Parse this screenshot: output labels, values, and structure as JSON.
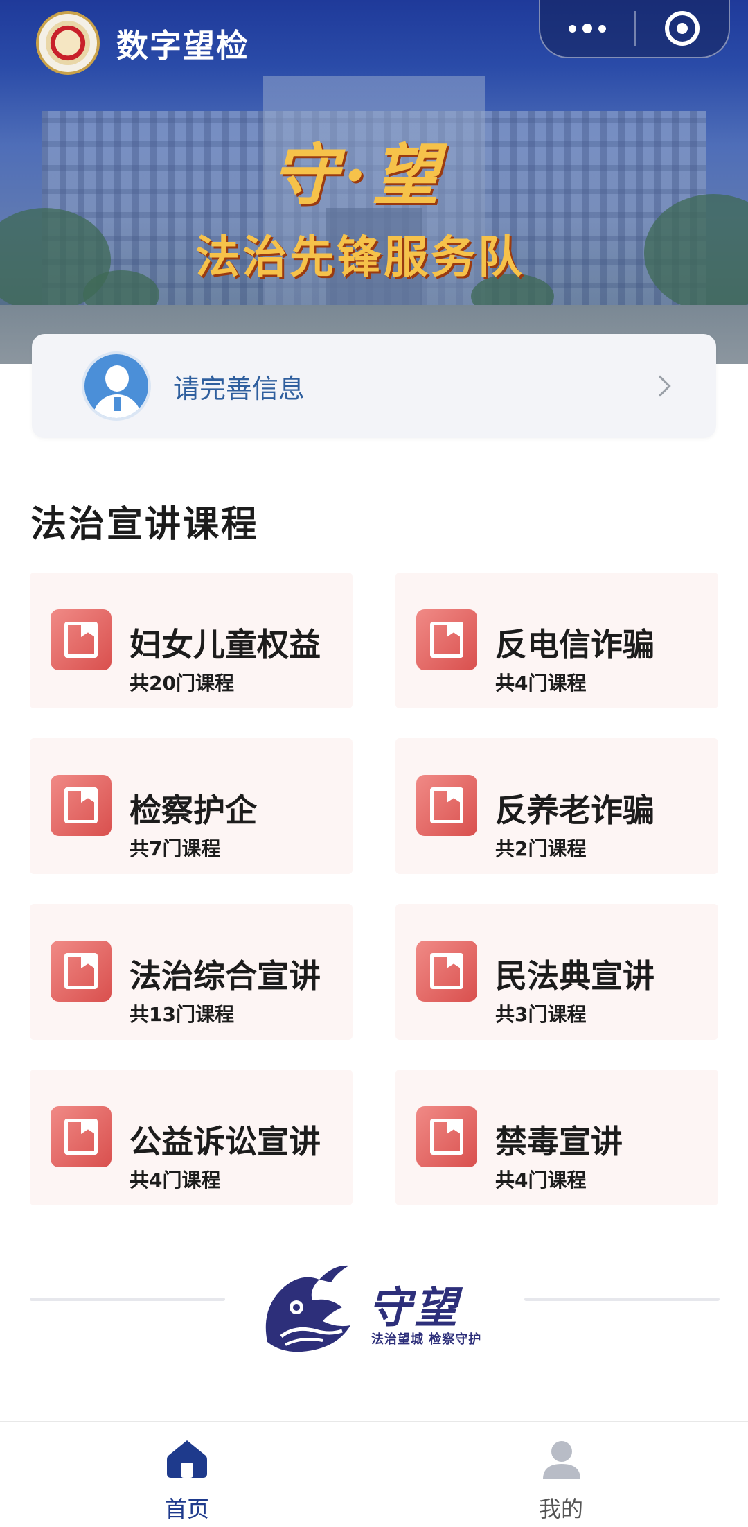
{
  "header": {
    "app_title": "数字望检",
    "capsule_more_icon": "more-dots-icon",
    "capsule_close_icon": "target-close-icon"
  },
  "banner": {
    "slogan_line1": "守·望",
    "slogan_line2": "法治先锋服务队"
  },
  "profile": {
    "prompt": "请完善信息"
  },
  "section": {
    "title": "法治宣讲课程"
  },
  "courses": [
    {
      "title": "妇女儿童权益",
      "count": "共20门课程"
    },
    {
      "title": "反电信诈骗",
      "count": "共4门课程"
    },
    {
      "title": "检察护企",
      "count": "共7门课程"
    },
    {
      "title": "反养老诈骗",
      "count": "共2门课程"
    },
    {
      "title": "法治综合宣讲",
      "count": "共13门课程"
    },
    {
      "title": "民法典宣讲",
      "count": "共3门课程"
    },
    {
      "title": "公益诉讼宣讲",
      "count": "共4门课程"
    },
    {
      "title": "禁毒宣讲",
      "count": "共4门课程"
    }
  ],
  "footer_brand": {
    "name": "守望",
    "tagline": "法治望城 检察守护"
  },
  "tabbar": {
    "items": [
      {
        "label": "首页",
        "icon": "home-icon",
        "active": true
      },
      {
        "label": "我的",
        "icon": "user-icon",
        "active": false
      }
    ],
    "active_color": "#1e3a8c",
    "inactive_color": "#555555"
  },
  "colors": {
    "banner_blue": "#1f3a9a",
    "slogan_gold": "#f6c24a",
    "card_bg": "#fdf5f4",
    "card_icon": "#e06562",
    "profile_text": "#2f5f9e"
  }
}
